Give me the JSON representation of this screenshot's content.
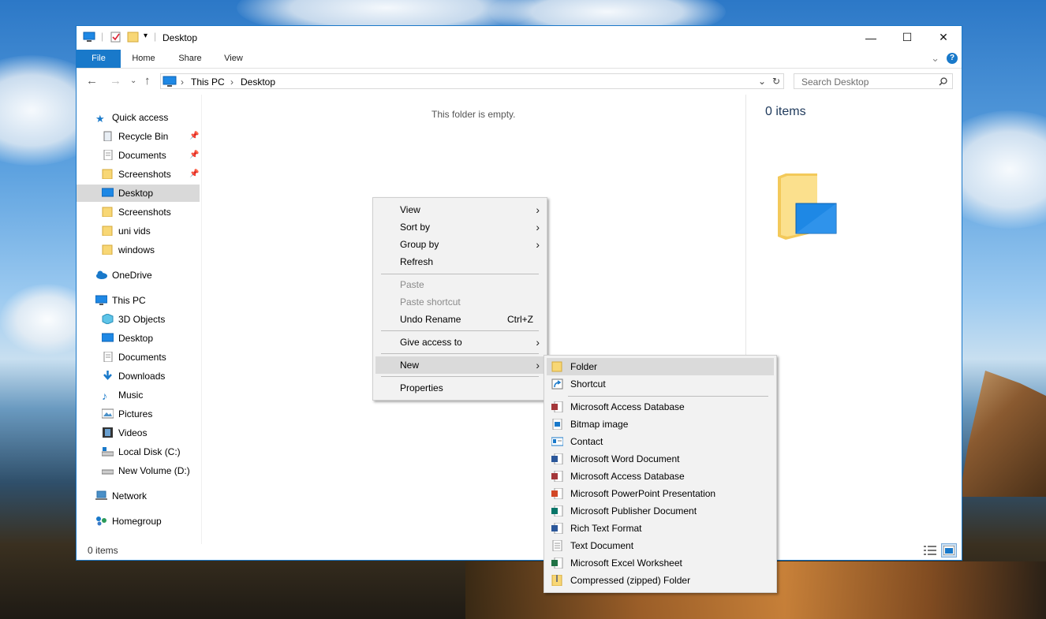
{
  "window": {
    "title": "Desktop",
    "controls": {
      "minimize": "—",
      "maximize": "☐",
      "close": "✕"
    }
  },
  "ribbon": {
    "tabs": [
      "File",
      "Home",
      "Share",
      "View"
    ],
    "expand_icon": "⌄",
    "help_icon": "?"
  },
  "address": {
    "crumbs": [
      "This PC",
      "Desktop"
    ],
    "search_placeholder": "Search Desktop"
  },
  "nav": {
    "quick_access": "Quick access",
    "quick_items": [
      "Recycle Bin",
      "Documents",
      "Screenshots",
      "Desktop",
      "Screenshots",
      "uni vids",
      "windows"
    ],
    "onedrive": "OneDrive",
    "this_pc": "This PC",
    "pc_items": [
      "3D Objects",
      "Desktop",
      "Documents",
      "Downloads",
      "Music",
      "Pictures",
      "Videos",
      "Local Disk (C:)",
      "New Volume (D:)"
    ],
    "network": "Network",
    "homegroup": "Homegroup"
  },
  "content": {
    "empty_message": "This folder is empty."
  },
  "preview": {
    "items_count": "0 items"
  },
  "status": {
    "items": "0 items"
  },
  "context_menu": {
    "view": "View",
    "sort_by": "Sort by",
    "group_by": "Group by",
    "refresh": "Refresh",
    "paste": "Paste",
    "paste_shortcut": "Paste shortcut",
    "undo_rename": "Undo Rename",
    "undo_shortcut": "Ctrl+Z",
    "give_access": "Give access to",
    "new": "New",
    "properties": "Properties"
  },
  "new_submenu": {
    "folder": "Folder",
    "shortcut": "Shortcut",
    "items": [
      "Microsoft Access Database",
      "Bitmap image",
      "Contact",
      "Microsoft Word Document",
      "Microsoft Access Database",
      "Microsoft PowerPoint Presentation",
      "Microsoft Publisher Document",
      "Rich Text Format",
      "Text Document",
      "Microsoft Excel Worksheet",
      "Compressed (zipped) Folder"
    ]
  },
  "colors": {
    "accent": "#1979ca",
    "folder": "#f8d775",
    "selection": "#d9d9d9"
  }
}
